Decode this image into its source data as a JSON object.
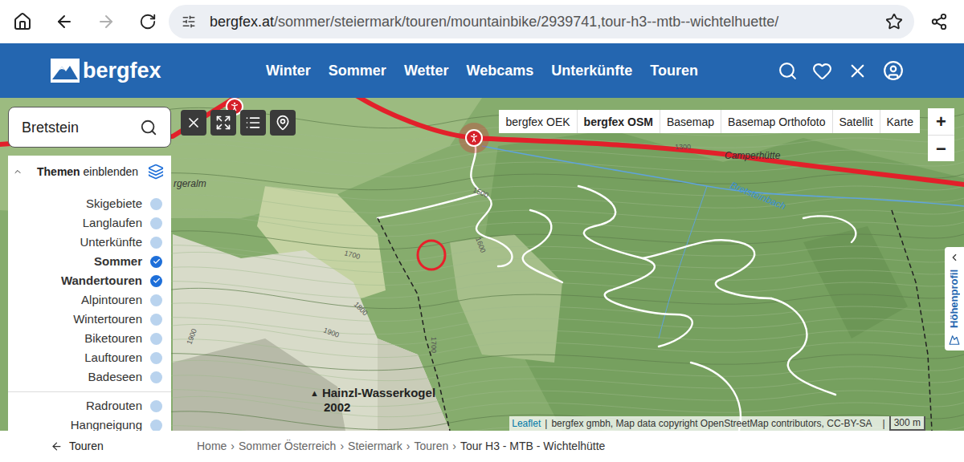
{
  "browser": {
    "url_host": "bergfex.at",
    "url_path": "/sommer/steiermark/touren/mountainbike/2939741,tour-h3--mtb--wichtelhuette/",
    "forward_enabled": false
  },
  "header": {
    "logo": "bergfex",
    "nav": [
      "Winter",
      "Sommer",
      "Wetter",
      "Webcams",
      "Unterkünfte",
      "Touren"
    ]
  },
  "map": {
    "search": {
      "value": "Bretstein"
    },
    "layers_panel": {
      "title_bold": "Themen",
      "title_rest": "einblenden",
      "expanded": true,
      "groups": [
        [
          {
            "label": "Skigebiete",
            "checked": false
          },
          {
            "label": "Langlaufen",
            "checked": false
          },
          {
            "label": "Unterkünfte",
            "checked": false
          },
          {
            "label": "Sommer",
            "checked": true
          },
          {
            "label": "Wandertouren",
            "checked": true
          },
          {
            "label": "Alpintouren",
            "checked": false
          },
          {
            "label": "Wintertouren",
            "checked": false
          },
          {
            "label": "Biketouren",
            "checked": false
          },
          {
            "label": "Lauftouren",
            "checked": false
          },
          {
            "label": "Badeseen",
            "checked": false
          }
        ],
        [
          {
            "label": "Radrouten",
            "checked": false
          },
          {
            "label": "Hangneigung",
            "checked": false
          }
        ]
      ]
    },
    "layer_switch": [
      {
        "label": "bergfex OEK",
        "selected": false
      },
      {
        "label": "bergfex OSM",
        "selected": true
      },
      {
        "label": "Basemap",
        "selected": false
      },
      {
        "label": "Basemap Orthofoto",
        "selected": false
      },
      {
        "label": "Satellit",
        "selected": false
      },
      {
        "label": "Karte",
        "selected": false
      }
    ],
    "zoom": [
      "+",
      "−"
    ],
    "side_tab": "Höhenprofil",
    "labels": [
      "rgeralm",
      "1300",
      "Camperhütte",
      "Bretsteinbach",
      "1500",
      "1600",
      "1700",
      "1800",
      "1900",
      "1700",
      "1900"
    ],
    "peak": {
      "marker": "▲",
      "name": "Hainzl-Wasserkogel",
      "elevation": "2002"
    },
    "attribution_link": "Leaflet",
    "attribution_separator": "|",
    "attribution_text": "bergfex gmbh, Map data copyright OpenStreetMap contributors, CC-BY-SA",
    "scale": "300 m"
  },
  "footer": {
    "back": "Touren",
    "breadcrumb": [
      "Home",
      "Sommer Österreich",
      "Steiermark",
      "Touren",
      "Tour H3 - MTB - Wichtelhütte"
    ],
    "separator": "›"
  }
}
